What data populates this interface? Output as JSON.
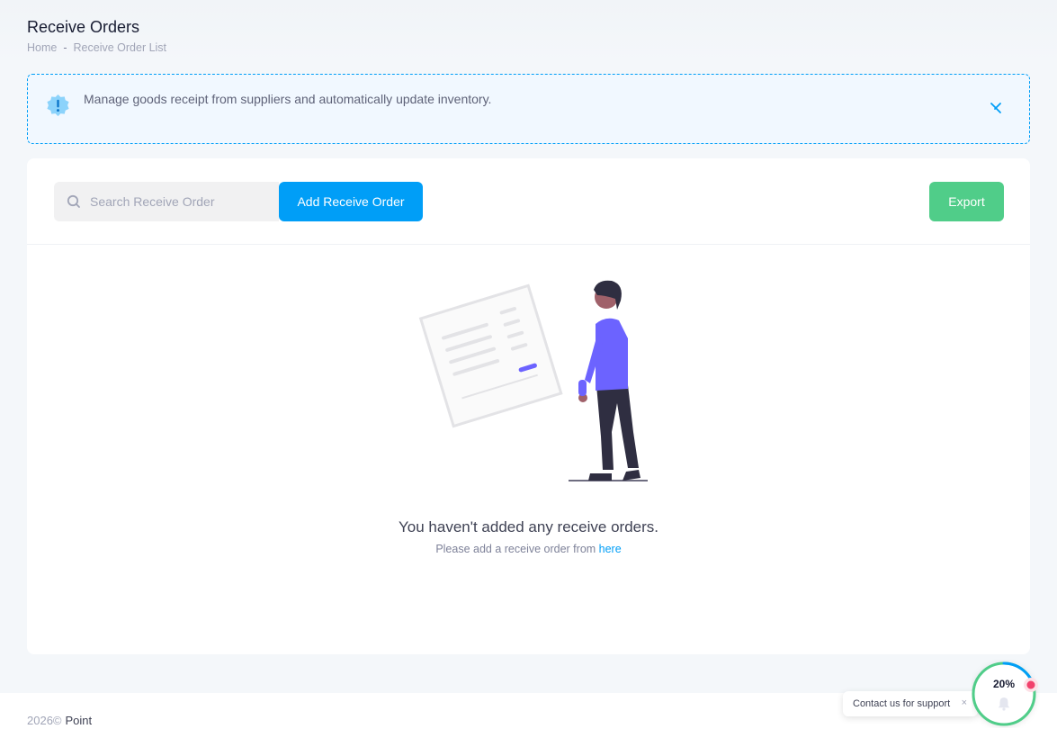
{
  "header": {
    "title": "Receive Orders",
    "breadcrumb": {
      "home": "Home",
      "separator": "-",
      "current": "Receive Order List"
    }
  },
  "notice": {
    "message": "Manage goods receipt from suppliers and automatically update inventory.",
    "icon": "exclamation-badge-icon",
    "close_icon": "close-icon"
  },
  "toolbar": {
    "search_placeholder": "Search Receive Order",
    "search_value": "",
    "add_label": "Add Receive Order",
    "export_label": "Export"
  },
  "empty_state": {
    "title": "You haven't added any receive orders.",
    "subtitle_prefix": "Please add a receive order from ",
    "link_text": "here"
  },
  "footer": {
    "year": "2026©",
    "brand": "Point"
  },
  "support": {
    "label": "Contact us for support",
    "close": "×"
  },
  "progress": {
    "percent_label": "20%",
    "value": 0.2
  },
  "colors": {
    "primary": "#009ef7",
    "success": "#50cd89",
    "illustration_accent": "#6c63ff"
  }
}
